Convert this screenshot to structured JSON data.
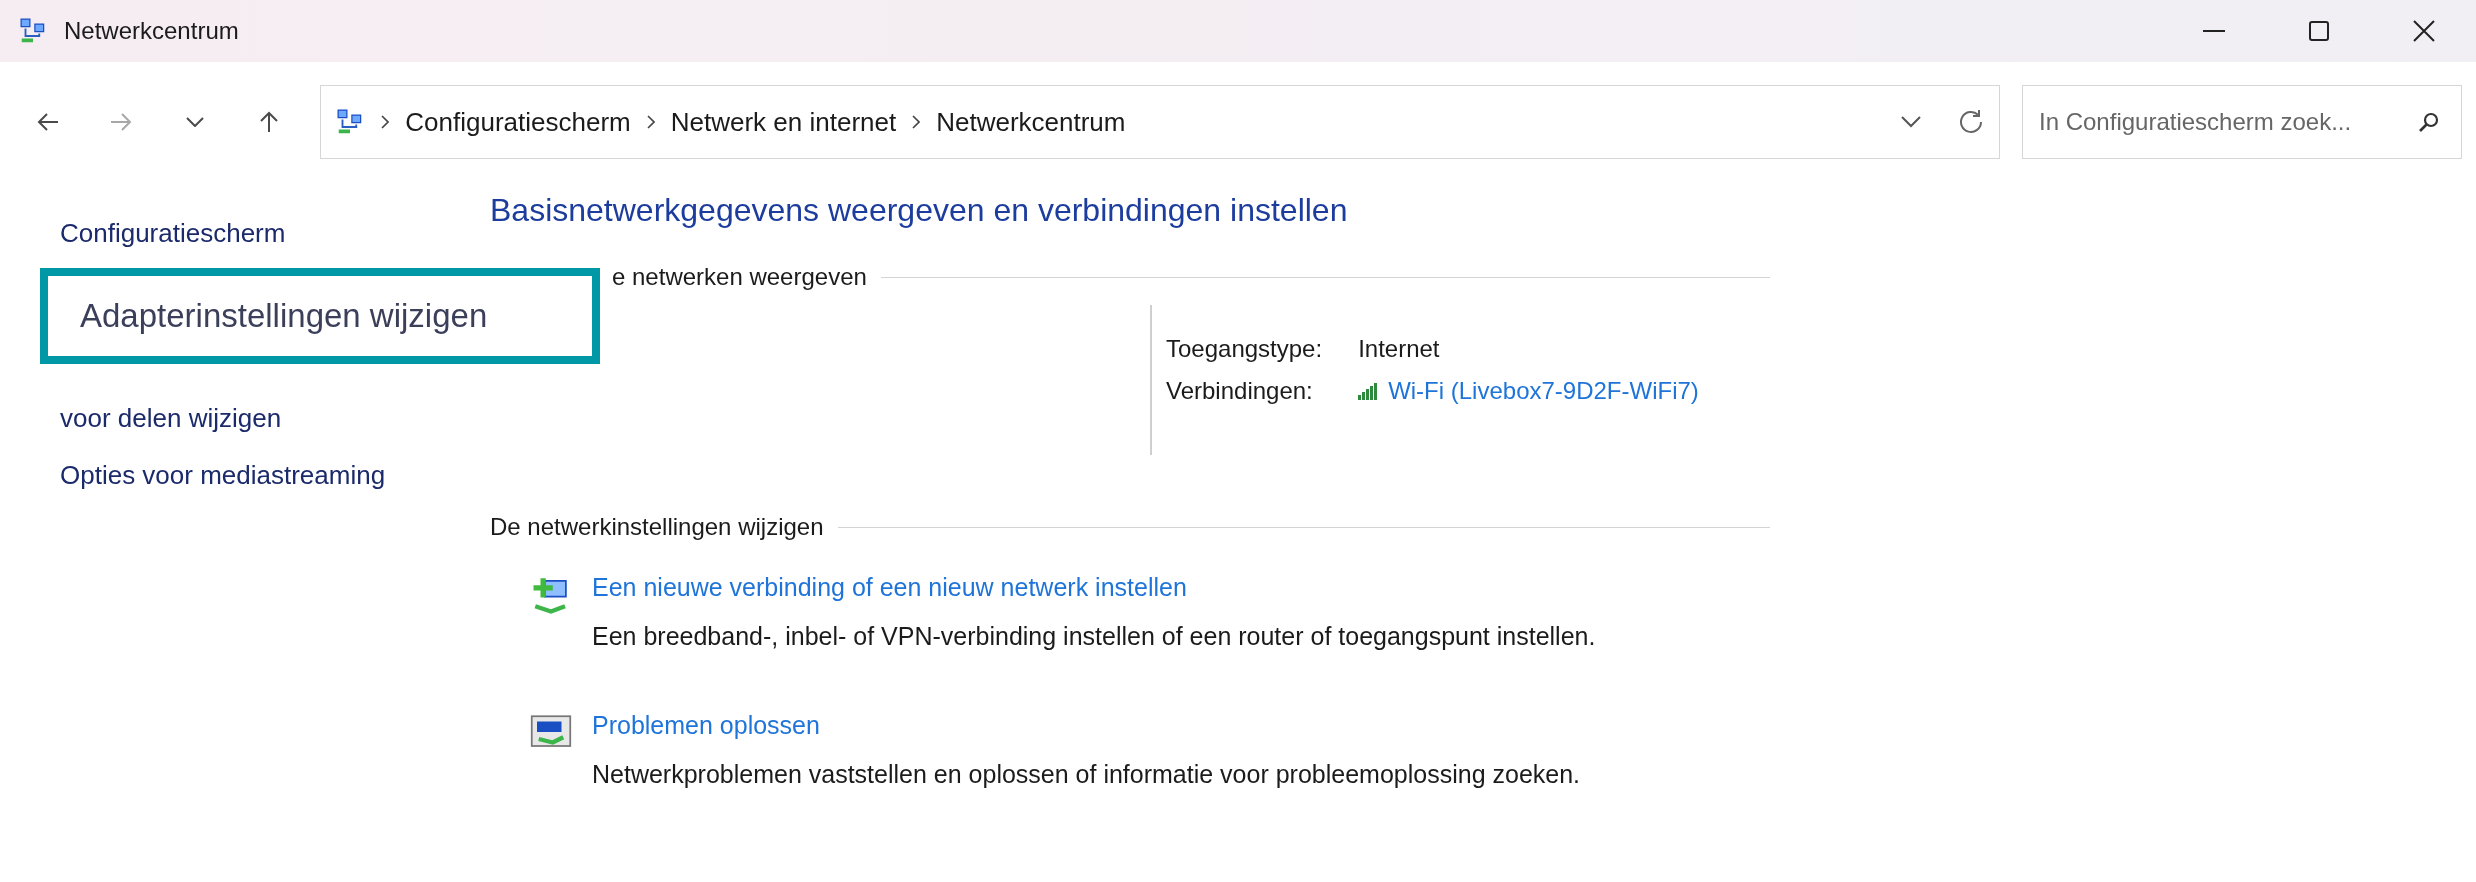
{
  "window": {
    "title": "Netwerkcentrum"
  },
  "nav": {
    "buttons": [
      {
        "kind": "back",
        "disabled": false
      },
      {
        "kind": "forward",
        "disabled": true
      },
      {
        "kind": "recent",
        "disabled": false
      },
      {
        "kind": "up",
        "disabled": false
      }
    ]
  },
  "breadcrumb": [
    "Configuratiescherm",
    "Netwerk en internet",
    "Netwerkcentrum"
  ],
  "search": {
    "placeholder": "In Configuratiescherm zoek..."
  },
  "sidebar": {
    "items": [
      {
        "label": "Configuratiescherm"
      },
      {
        "label": "voor delen wijzigen"
      },
      {
        "label": "Opties voor mediastreaming"
      }
    ]
  },
  "callout": {
    "text": "Adapterinstellingen wijzigen",
    "color": "#0097a7"
  },
  "main": {
    "title": "Basisnetwerkgegevens weergeven en verbindingen instellen",
    "active_section": {
      "heading": "e netwerken weergeven",
      "access_label": "Toegangstype:",
      "access_value": "Internet",
      "connections_label": "Verbindingen:",
      "connection_link": "Wi-Fi (Livebox7-9D2F-WiFi7)"
    },
    "change_section": {
      "heading": "De netwerkinstellingen wijzigen",
      "tasks": [
        {
          "kind": "new-connection",
          "link": "Een nieuwe verbinding of een nieuw netwerk instellen",
          "description": "Een breedband-, inbel- of VPN-verbinding instellen of een router of toegangspunt instellen."
        },
        {
          "kind": "troubleshoot",
          "link": "Problemen oplossen",
          "description": "Netwerkproblemen vaststellen en oplossen of informatie voor probleemoplossing zoeken."
        }
      ]
    }
  }
}
